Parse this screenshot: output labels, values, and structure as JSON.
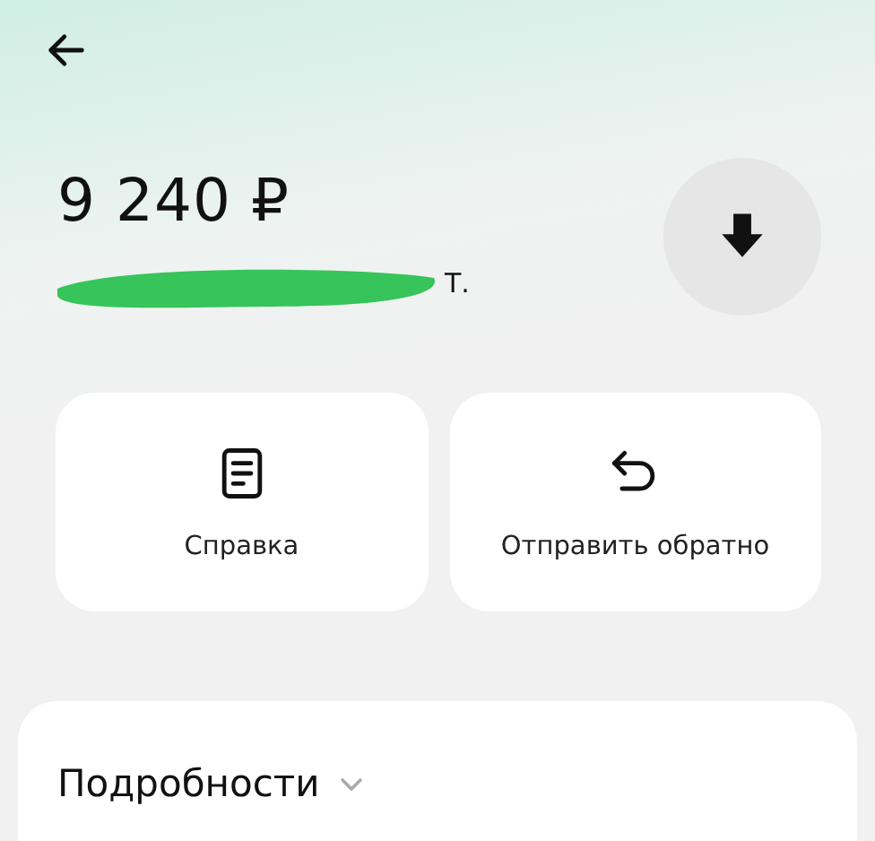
{
  "amount": "9 240 ₽",
  "sender": {
    "visible_text": "Т.",
    "redacted": true
  },
  "actions": [
    {
      "kind": "document",
      "label": "Справка"
    },
    {
      "kind": "return",
      "label": "Отправить обратно"
    }
  ],
  "details": {
    "title": "Подробности",
    "expanded": false
  }
}
